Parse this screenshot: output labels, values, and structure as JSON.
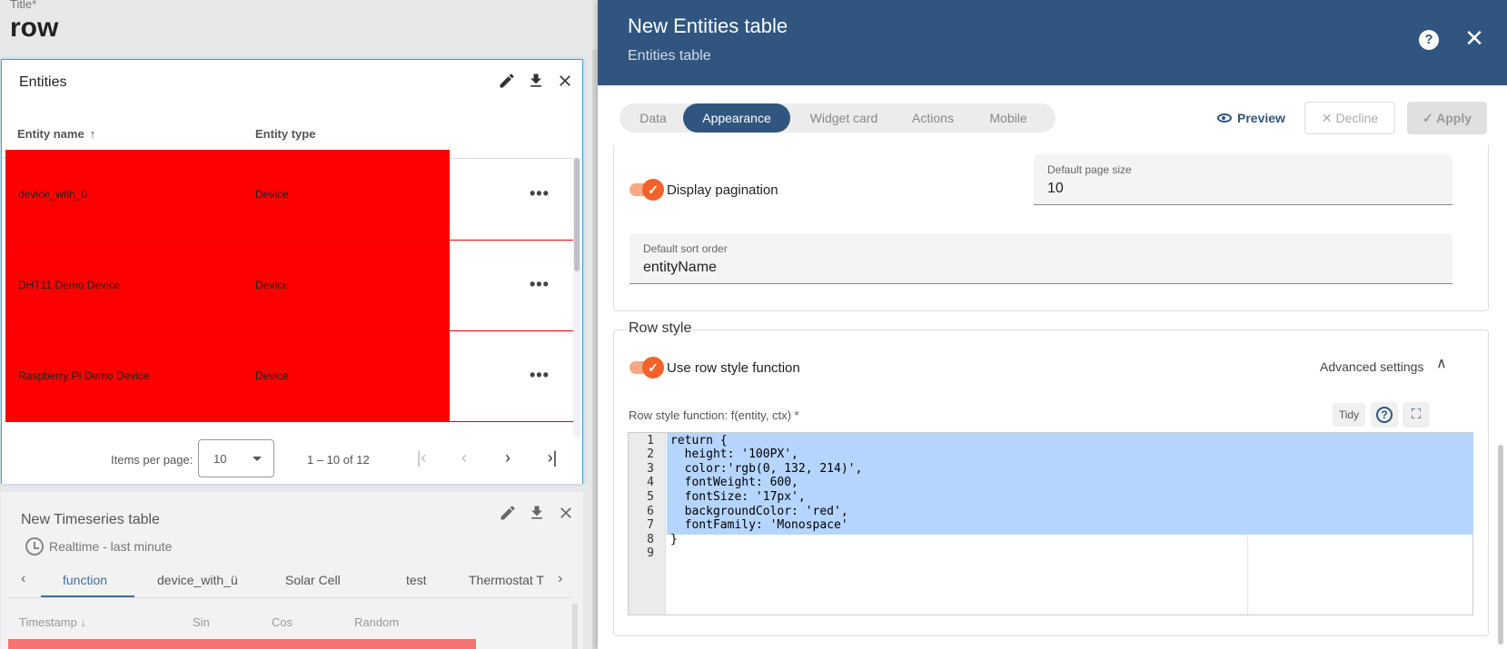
{
  "left": {
    "title_label": "Title*",
    "title_value": "row",
    "entities_widget": {
      "title": "Entities",
      "columns": [
        "Entity name",
        "Entity type"
      ],
      "sort_arrow": "↑",
      "rows": [
        {
          "name": "device_with_ü",
          "type": "Device",
          "more": "•••"
        },
        {
          "name": "DHT11 Demo Device",
          "type": "Device",
          "more": "•••"
        },
        {
          "name": "Raspberry Pi Demo Device",
          "type": "Device",
          "more": "•••"
        }
      ],
      "row_bg_color": "#ff0000",
      "pager": {
        "items_per_page_label": "Items per page:",
        "items_per_page_value": "10",
        "range": "1 – 10 of 12"
      }
    },
    "timeseries_widget": {
      "title": "New Timeseries table",
      "realtime": "Realtime - last minute",
      "tabs": [
        "function",
        "device_with_ü",
        "Solar Cell",
        "test",
        "Thermostat T"
      ],
      "active_tab": "function",
      "columns": [
        "Timestamp",
        "Sin",
        "Cos",
        "Random"
      ],
      "sort_arrow": "↓"
    }
  },
  "dialog": {
    "title": "New Entities table",
    "subtitle": "Entities table",
    "header_color": "#305680",
    "tabs": [
      "Data",
      "Appearance",
      "Widget card",
      "Actions",
      "Mobile"
    ],
    "active_tab": "Appearance",
    "preview_label": "Preview",
    "decline_label": "Decline",
    "apply_label": "Apply",
    "display_pagination_label": "Display pagination",
    "default_page_size": {
      "label": "Default page size",
      "value": "10"
    },
    "default_sort_order": {
      "label": "Default sort order",
      "value": "entityName"
    },
    "row_style": {
      "legend": "Row style",
      "use_function_label": "Use row style function",
      "advanced_settings": "Advanced settings",
      "function_label": "Row style function: f(entity, ctx) *",
      "tidy_label": "Tidy",
      "code_lines": [
        {
          "n": "1",
          "text": "return {"
        },
        {
          "n": "2",
          "text": "  height: '100PX',"
        },
        {
          "n": "3",
          "text": "  color:'rgb(0, 132, 214)',"
        },
        {
          "n": "4",
          "text": "  fontWeight: 600,"
        },
        {
          "n": "5",
          "text": "  fontSize: '17px',"
        },
        {
          "n": "6",
          "text": "  backgroundColor: 'red',"
        },
        {
          "n": "7",
          "text": "  fontFamily: 'Monospace'"
        },
        {
          "n": "8",
          "text": "}"
        },
        {
          "n": "9",
          "text": ""
        }
      ]
    },
    "toggle_color": "#f2622a"
  }
}
